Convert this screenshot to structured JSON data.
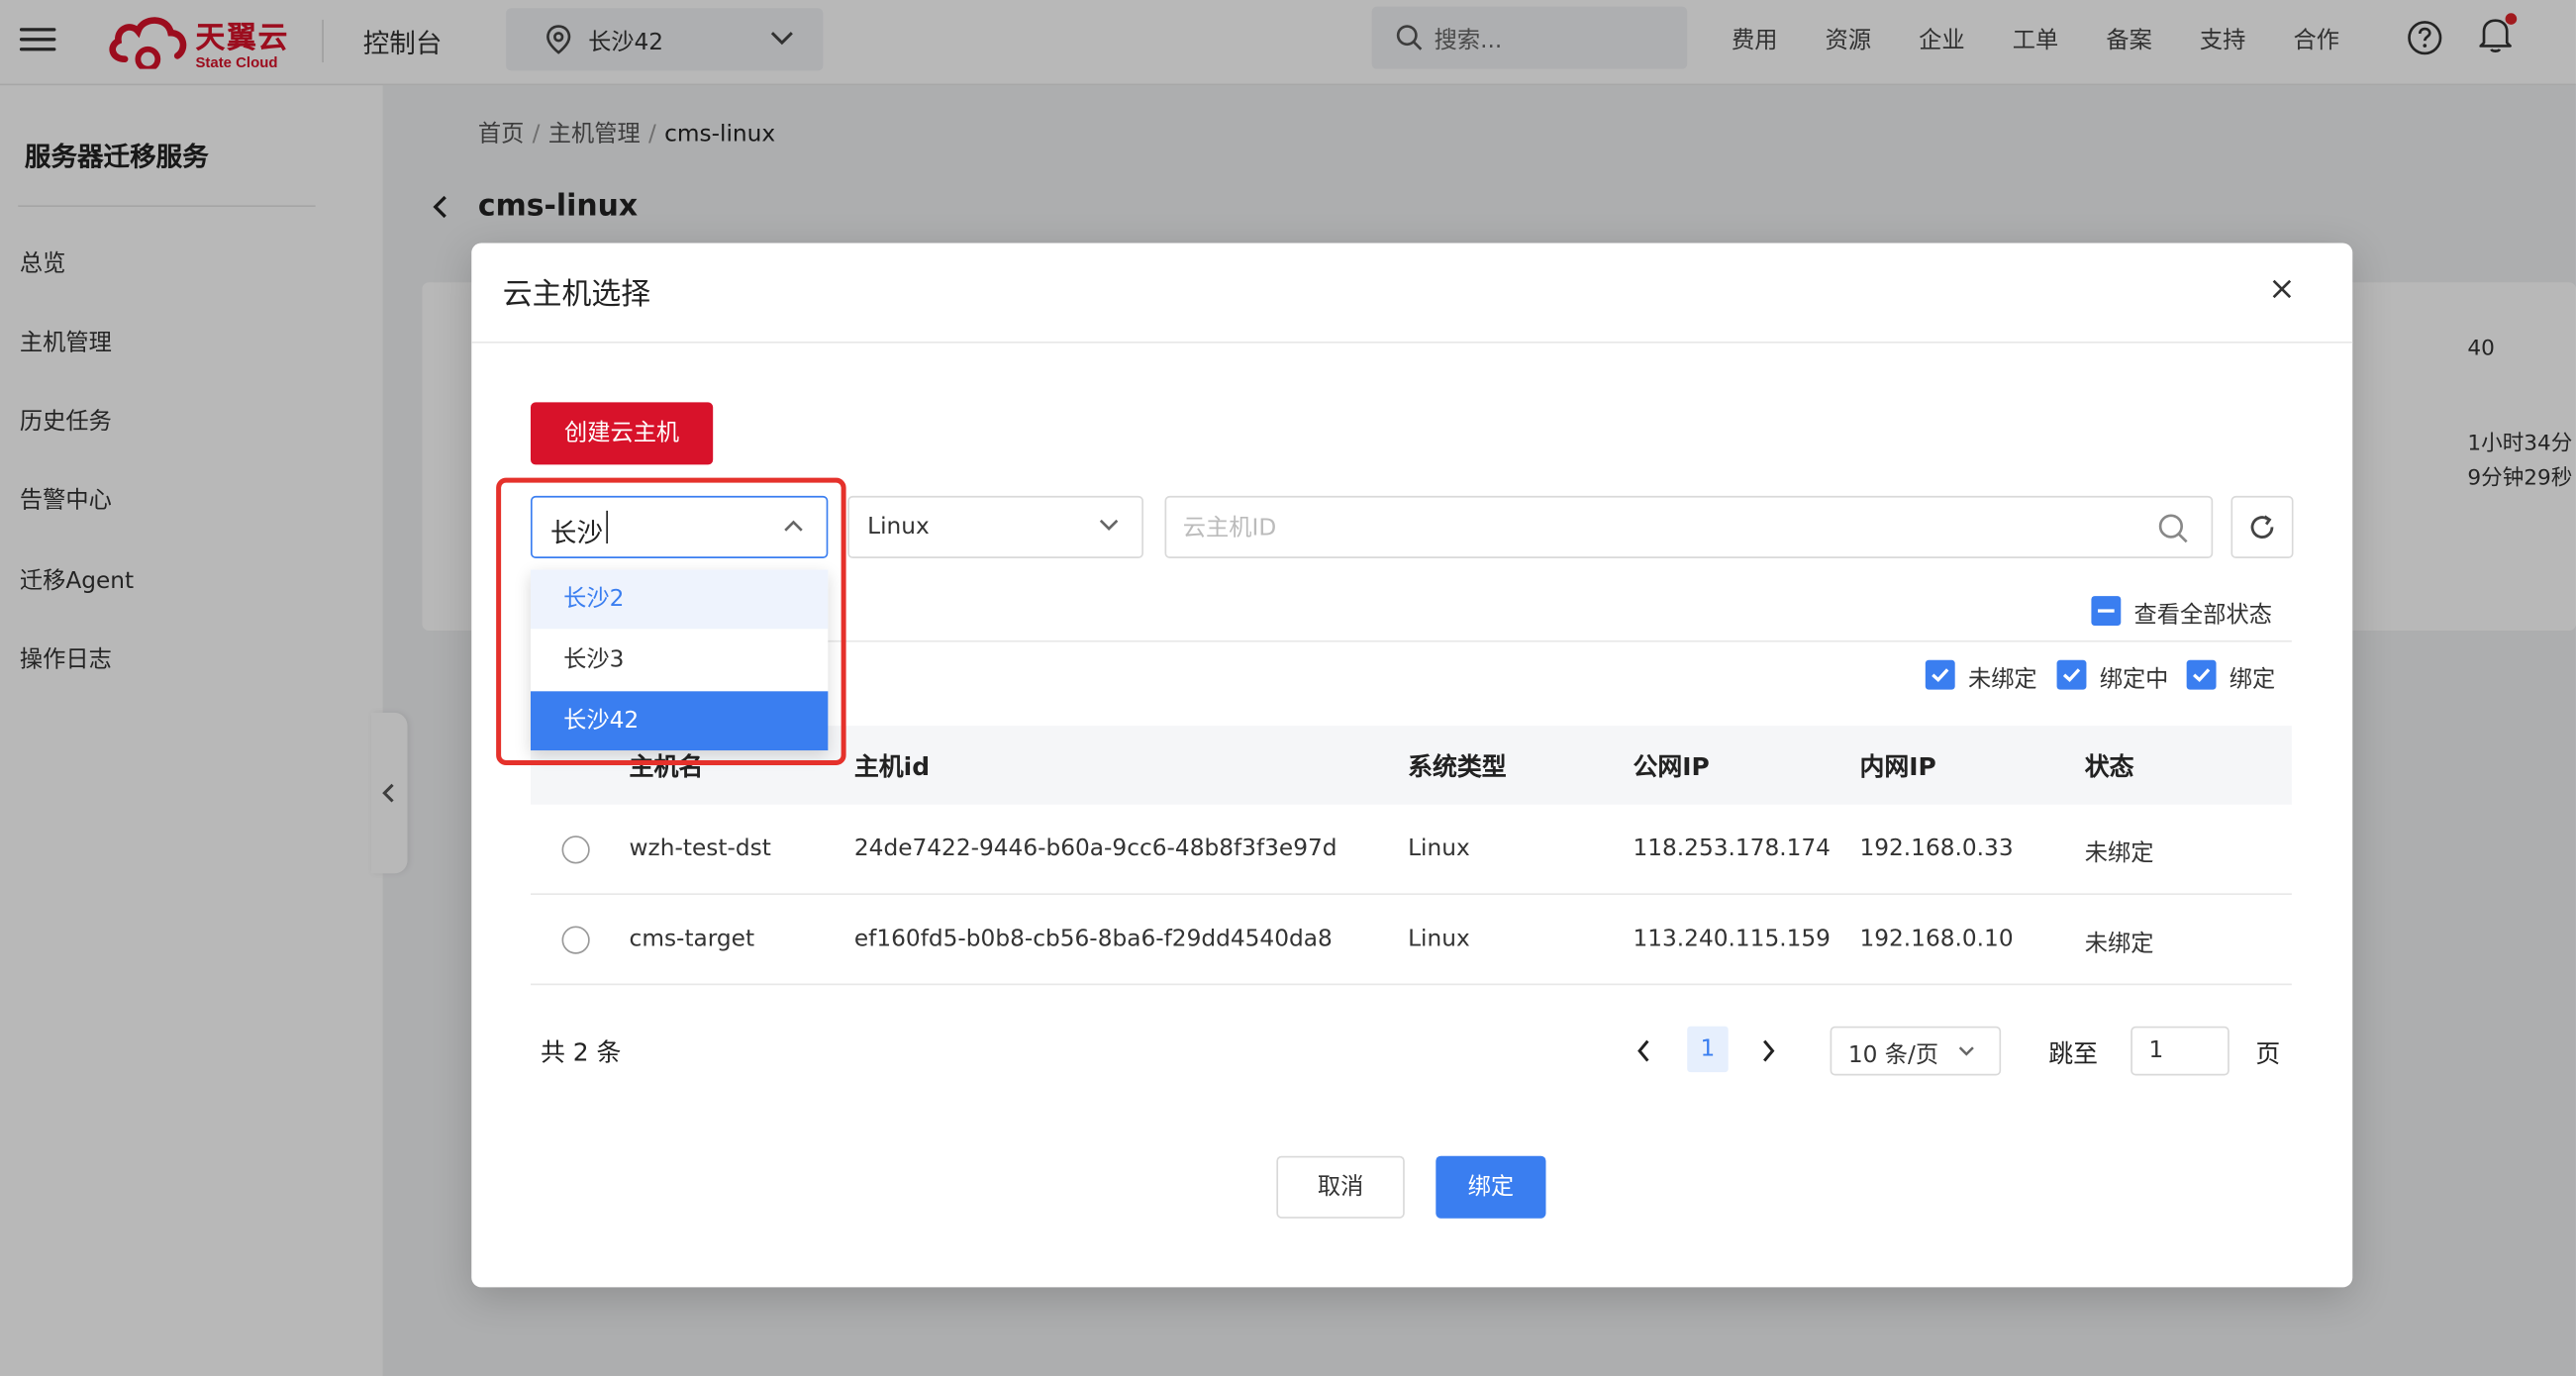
{
  "topbar": {
    "logo_cn": "天翼云",
    "logo_en": "State Cloud",
    "console_label": "控制台",
    "region_value": "长沙42",
    "search_placeholder": "搜索...",
    "nav": [
      "费用",
      "资源",
      "企业",
      "工单",
      "备案",
      "支持",
      "合作"
    ]
  },
  "sidebar": {
    "title": "服务器迁移服务",
    "items": [
      "总览",
      "主机管理",
      "历史任务",
      "告警中心",
      "迁移Agent",
      "操作日志"
    ]
  },
  "breadcrumb": {
    "items": [
      "首页",
      "主机管理",
      "cms-linux"
    ],
    "separator": "/"
  },
  "page": {
    "title": "cms-linux",
    "bg_values": [
      "40",
      "1小时34分",
      "9分钟29秒"
    ]
  },
  "modal": {
    "title": "云主机选择",
    "create_button": "创建云主机",
    "region_input_value": "长沙",
    "os_select_value": "Linux",
    "id_search_placeholder": "云主机ID",
    "dropdown_options": [
      "长沙2",
      "长沙3",
      "长沙42"
    ],
    "dropdown_selected": "长沙42",
    "view_all_status": "查看全部状态",
    "status_filters": [
      "未绑定",
      "绑定中",
      "绑定"
    ],
    "table": {
      "columns": [
        "主机名",
        "主机id",
        "系统类型",
        "公网IP",
        "内网IP",
        "状态"
      ],
      "rows": [
        {
          "name": "wzh-test-dst",
          "id": "24de7422-9446-b60a-9cc6-48b8f3f3e97d",
          "os": "Linux",
          "public_ip": "118.253.178.174",
          "private_ip": "192.168.0.33",
          "status": "未绑定"
        },
        {
          "name": "cms-target",
          "id": "ef160fd5-b0b8-cb56-8ba6-f29dd4540da8",
          "os": "Linux",
          "public_ip": "113.240.115.159",
          "private_ip": "192.168.0.10",
          "status": "未绑定"
        }
      ]
    },
    "pagination": {
      "total_text": "共 2 条",
      "current_page": "1",
      "page_size": "10 条/页",
      "jump_label": "跳至",
      "jump_value": "1",
      "page_label": "页"
    },
    "cancel_button": "取消",
    "bind_button": "绑定"
  },
  "colors": {
    "brand_red": "#d8122a",
    "primary_blue": "#3a7ef0",
    "highlight_red": "#e5312b"
  }
}
